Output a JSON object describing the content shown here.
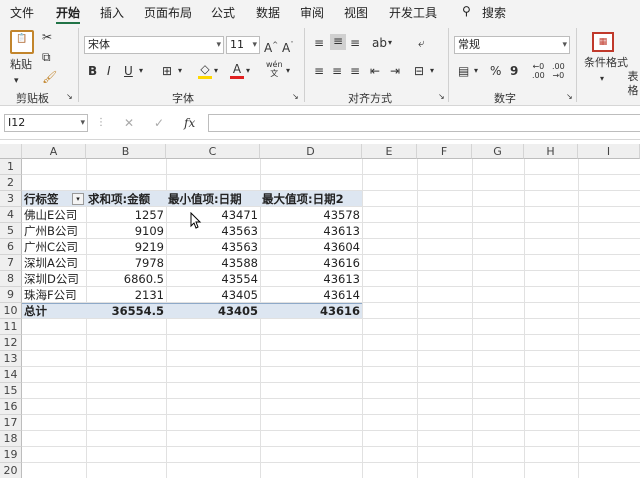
{
  "menu": {
    "tabs": [
      "文件",
      "开始",
      "插入",
      "页面布局",
      "公式",
      "数据",
      "审阅",
      "视图",
      "开发工具"
    ],
    "search_label": "搜索"
  },
  "ribbon": {
    "paste_label": "粘贴",
    "clipboard_label": "剪贴板",
    "font_name": "宋体",
    "font_size": "11",
    "font_group_label": "字体",
    "align_group_label": "对齐方式",
    "number_format": "常规",
    "number_group_label": "数字",
    "conditional_label": "条件格式",
    "table_label": "表格"
  },
  "formula_bar": {
    "name_box": "I12",
    "fx": "fx",
    "content": ""
  },
  "sheet": {
    "columns": [
      "A",
      "B",
      "C",
      "D",
      "E",
      "F",
      "G",
      "H",
      "I"
    ],
    "rows": [
      "1",
      "2",
      "3",
      "4",
      "5",
      "6",
      "7",
      "8",
      "9",
      "10",
      "11",
      "12",
      "13",
      "14",
      "15",
      "16",
      "17",
      "18",
      "19",
      "20"
    ],
    "pivot_headers": [
      "行标签",
      "求和项:金额",
      "最小值项:日期",
      "最大值项:日期2"
    ],
    "pivot_rows": [
      [
        "佛山E公司",
        "1257",
        "43471",
        "43578"
      ],
      [
        "广州B公司",
        "9109",
        "43563",
        "43613"
      ],
      [
        "广州C公司",
        "9219",
        "43563",
        "43604"
      ],
      [
        "深圳A公司",
        "7978",
        "43588",
        "43616"
      ],
      [
        "深圳D公司",
        "6860.5",
        "43554",
        "43613"
      ],
      [
        "珠海F公司",
        "2131",
        "43405",
        "43614"
      ]
    ],
    "total_row": [
      "总计",
      "36554.5",
      "43405",
      "43616"
    ]
  }
}
